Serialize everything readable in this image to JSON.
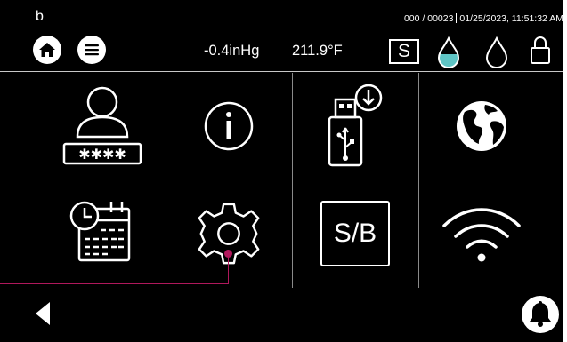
{
  "header": {
    "brand": "b",
    "counter": "000 / 00023",
    "datetime": "01/25/2023, 11:51:32 AM",
    "pressure": "-0.4inHg",
    "temperature": "211.9°F",
    "status_label": "S"
  },
  "tiles": {
    "sb_label": "S/B"
  },
  "icons": {
    "home": "home-icon",
    "menu": "menu-icon",
    "drop_filled": "water-drop-filled-icon",
    "drop_empty": "water-drop-outline-icon",
    "lock": "lock-icon",
    "user": "user-password-icon",
    "info": "info-icon",
    "usb": "usb-download-icon",
    "globe": "globe-icon",
    "schedule": "calendar-clock-icon",
    "settings": "gear-icon",
    "wifi": "wifi-icon",
    "back": "back-arrow-icon",
    "bell": "bell-icon"
  },
  "colors": {
    "background": "#000000",
    "foreground": "#ffffff",
    "water_fill": "#5ec4c4",
    "annotation": "#b0185c"
  }
}
